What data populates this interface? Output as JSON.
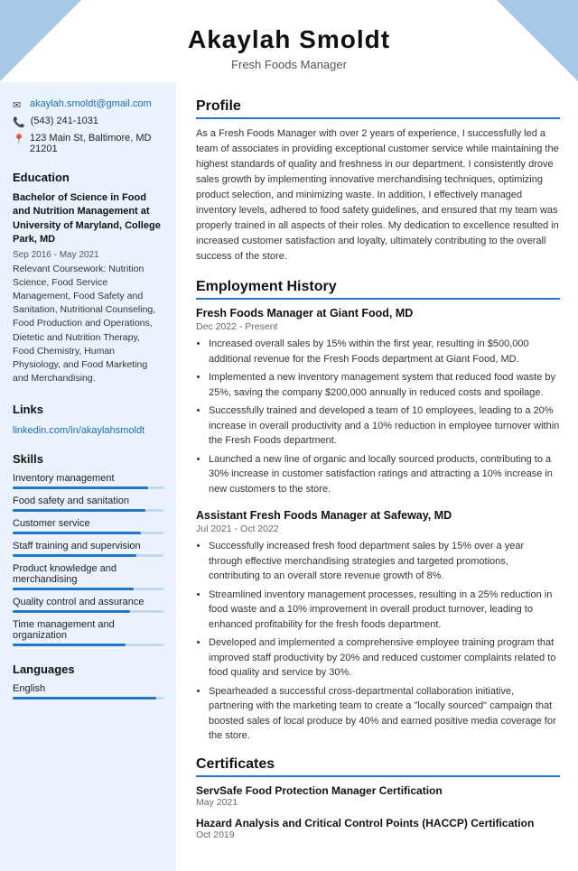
{
  "header": {
    "name": "Akaylah Smoldt",
    "title": "Fresh Foods Manager"
  },
  "sidebar": {
    "contact": {
      "email": "akaylah.smoldt@gmail.com",
      "phone": "(543) 241-1031",
      "address": "123 Main St, Baltimore, MD 21201"
    },
    "education": {
      "section_title": "Education",
      "degree": "Bachelor of Science in Food and Nutrition Management at University of Maryland, College Park, MD",
      "date": "Sep 2016 - May 2021",
      "coursework_label": "Relevant Coursework:",
      "coursework": "Nutrition Science, Food Service Management, Food Safety and Sanitation, Nutritional Counseling, Food Production and Operations, Dietetic and Nutrition Therapy, Food Chemistry, Human Physiology, and Food Marketing and Merchandising."
    },
    "links": {
      "section_title": "Links",
      "linkedin": "linkedin.com/in/akaylahsmoldt"
    },
    "skills": {
      "section_title": "Skills",
      "items": [
        {
          "label": "Inventory management",
          "pct": 90
        },
        {
          "label": "Food safety and sanitation",
          "pct": 88
        },
        {
          "label": "Customer service",
          "pct": 85
        },
        {
          "label": "Staff training and supervision",
          "pct": 82
        },
        {
          "label": "Product knowledge and merchandising",
          "pct": 80
        },
        {
          "label": "Quality control and assurance",
          "pct": 78
        },
        {
          "label": "Time management and organization",
          "pct": 75
        }
      ]
    },
    "languages": {
      "section_title": "Languages",
      "items": [
        {
          "label": "English",
          "pct": 95
        }
      ]
    }
  },
  "main": {
    "profile": {
      "section_title": "Profile",
      "text": "As a Fresh Foods Manager with over 2 years of experience, I successfully led a team of associates in providing exceptional customer service while maintaining the highest standards of quality and freshness in our department. I consistently drove sales growth by implementing innovative merchandising techniques, optimizing product selection, and minimizing waste. In addition, I effectively managed inventory levels, adhered to food safety guidelines, and ensured that my team was properly trained in all aspects of their roles. My dedication to excellence resulted in increased customer satisfaction and loyalty, ultimately contributing to the overall success of the store."
    },
    "employment": {
      "section_title": "Employment History",
      "jobs": [
        {
          "title": "Fresh Foods Manager at Giant Food, MD",
          "date": "Dec 2022 - Present",
          "bullets": [
            "Increased overall sales by 15% within the first year, resulting in $500,000 additional revenue for the Fresh Foods department at Giant Food, MD.",
            "Implemented a new inventory management system that reduced food waste by 25%, saving the company $200,000 annually in reduced costs and spoilage.",
            "Successfully trained and developed a team of 10 employees, leading to a 20% increase in overall productivity and a 10% reduction in employee turnover within the Fresh Foods department.",
            "Launched a new line of organic and locally sourced products, contributing to a 30% increase in customer satisfaction ratings and attracting a 10% increase in new customers to the store."
          ]
        },
        {
          "title": "Assistant Fresh Foods Manager at Safeway, MD",
          "date": "Jul 2021 - Oct 2022",
          "bullets": [
            "Successfully increased fresh food department sales by 15% over a year through effective merchandising strategies and targeted promotions, contributing to an overall store revenue growth of 8%.",
            "Streamlined inventory management processes, resulting in a 25% reduction in food waste and a 10% improvement in overall product turnover, leading to enhanced profitability for the fresh foods department.",
            "Developed and implemented a comprehensive employee training program that improved staff productivity by 20% and reduced customer complaints related to food quality and service by 30%.",
            "Spearheaded a successful cross-departmental collaboration initiative, partnering with the marketing team to create a \"locally sourced\" campaign that boosted sales of local produce by 40% and earned positive media coverage for the store."
          ]
        }
      ]
    },
    "certificates": {
      "section_title": "Certificates",
      "items": [
        {
          "title": "ServSafe Food Protection Manager Certification",
          "date": "May 2021"
        },
        {
          "title": "Hazard Analysis and Critical Control Points (HACCP) Certification",
          "date": "Oct 2019"
        }
      ]
    }
  }
}
